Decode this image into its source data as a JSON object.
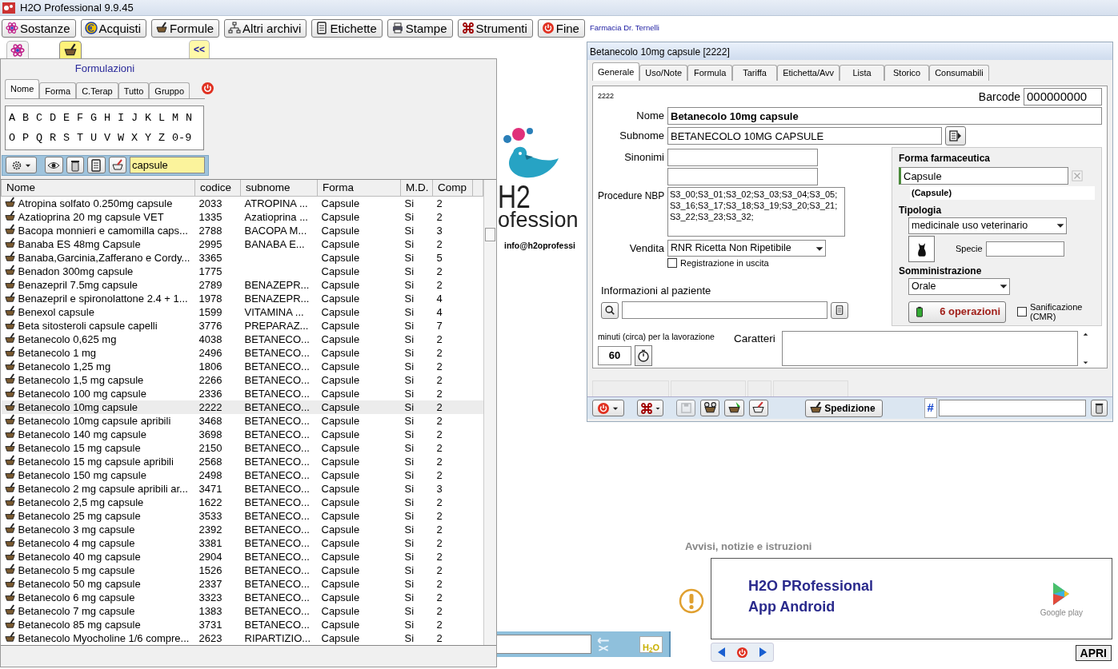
{
  "window": {
    "title": "H2O Professional 9.9.45"
  },
  "toolbar": {
    "buttons": [
      "Sostanze",
      "Acquisti",
      "Formule",
      "Altri archivi",
      "Etichette",
      "Stampe",
      "Strumenti",
      "Fine"
    ],
    "pharmacy": "Farmacia Dr. Ternelli"
  },
  "left_panel": {
    "top_tabs": [
      {
        "selected": false
      },
      {
        "selected": true
      }
    ],
    "collapse_button": "<<",
    "title": "Formulazioni",
    "filter_tabs": [
      {
        "label": "Nome",
        "selected": true
      },
      {
        "label": "Forma",
        "selected": false
      },
      {
        "label": "C.Terap",
        "selected": false
      },
      {
        "label": "Tutto",
        "selected": false
      },
      {
        "label": "Gruppo",
        "selected": false
      }
    ],
    "letters": [
      [
        "A",
        "B",
        "C",
        "D",
        "E",
        "F",
        "G",
        "H",
        "I",
        "J",
        "K",
        "L",
        "M",
        "N"
      ],
      [
        "O",
        "P",
        "Q",
        "R",
        "S",
        "T",
        "U",
        "V",
        "W",
        "X",
        "Y",
        "Z",
        "0-9"
      ]
    ],
    "search": {
      "value": "capsule"
    },
    "table": {
      "columns": [
        "Nome",
        "codice",
        "subnome",
        "Forma",
        "M.D.",
        "Comp"
      ],
      "rows": [
        {
          "nome": "Atropina solfato 0.250mg capsule",
          "codice": "2033",
          "subnome": "ATROPINA ...",
          "forma": "Capsule",
          "md": "Si",
          "comp": "2",
          "selected": false
        },
        {
          "nome": "Azatioprina 20 mg capsule VET",
          "codice": "1335",
          "subnome": "Azatioprina ...",
          "forma": "Capsule",
          "md": "Si",
          "comp": "2",
          "selected": false
        },
        {
          "nome": "Bacopa monnieri e camomilla caps...",
          "codice": "2788",
          "subnome": "BACOPA M...",
          "forma": "Capsule",
          "md": "Si",
          "comp": "3",
          "selected": false
        },
        {
          "nome": "Banaba ES  48mg Capsule",
          "codice": "2995",
          "subnome": "BANABA E...",
          "forma": "Capsule",
          "md": "Si",
          "comp": "2",
          "selected": false
        },
        {
          "nome": "Banaba,Garcinia,Zafferano e Cordy...",
          "codice": "3365",
          "forma": "Capsule",
          "md": "Si",
          "comp": "5",
          "selected": false
        },
        {
          "nome": "Benadon 300mg capsule",
          "codice": "1775",
          "forma": "Capsule",
          "md": "Si",
          "comp": "2",
          "selected": false
        },
        {
          "nome": "Benazepril 7.5mg capsule",
          "codice": "2789",
          "subnome": "BENAZEPR...",
          "forma": "Capsule",
          "md": "Si",
          "comp": "2",
          "selected": false
        },
        {
          "nome": "Benazepril e spironolattone 2.4 + 1...",
          "codice": "1978",
          "subnome": "BENAZEPR...",
          "forma": "Capsule",
          "md": "Si",
          "comp": "4",
          "selected": false
        },
        {
          "nome": "Benexol capsule",
          "codice": "1599",
          "subnome": "VITAMINA ...",
          "forma": "Capsule",
          "md": "Si",
          "comp": "4",
          "selected": false
        },
        {
          "nome": "Beta sitosteroli capsule capelli",
          "codice": "3776",
          "subnome": "PREPARAZ...",
          "forma": "Capsule",
          "md": "Si",
          "comp": "7",
          "selected": false
        },
        {
          "nome": "Betanecolo 0,625 mg",
          "codice": "4038",
          "subnome": "BETANECO...",
          "forma": "Capsule",
          "md": "Si",
          "comp": "2",
          "selected": false
        },
        {
          "nome": "Betanecolo 1 mg",
          "codice": "2496",
          "subnome": "BETANECO...",
          "forma": "Capsule",
          "md": "Si",
          "comp": "2",
          "selected": false
        },
        {
          "nome": "Betanecolo 1,25 mg",
          "codice": "1806",
          "subnome": "BETANECO...",
          "forma": "Capsule",
          "md": "Si",
          "comp": "2",
          "selected": false
        },
        {
          "nome": "Betanecolo 1,5 mg capsule",
          "codice": "2266",
          "subnome": "BETANECO...",
          "forma": "Capsule",
          "md": "Si",
          "comp": "2",
          "selected": false
        },
        {
          "nome": "Betanecolo 100 mg capsule",
          "codice": "2336",
          "subnome": "BETANECO...",
          "forma": "Capsule",
          "md": "Si",
          "comp": "2",
          "selected": false
        },
        {
          "nome": "Betanecolo 10mg capsule",
          "codice": "2222",
          "subnome": "BETANECO...",
          "forma": "Capsule",
          "md": "Si",
          "comp": "2",
          "selected": true
        },
        {
          "nome": "Betanecolo 10mg capsule apribili",
          "codice": "3468",
          "subnome": "BETANECO...",
          "forma": "Capsule",
          "md": "Si",
          "comp": "2",
          "selected": false
        },
        {
          "nome": "Betanecolo 140 mg capsule",
          "codice": "3698",
          "subnome": "BETANECO...",
          "forma": "Capsule",
          "md": "Si",
          "comp": "2",
          "selected": false
        },
        {
          "nome": "Betanecolo 15 mg capsule",
          "codice": "2150",
          "subnome": "BETANECO...",
          "forma": "Capsule",
          "md": "Si",
          "comp": "2",
          "selected": false
        },
        {
          "nome": "Betanecolo 15 mg capsule apribili",
          "codice": "2568",
          "subnome": "BETANECO...",
          "forma": "Capsule",
          "md": "Si",
          "comp": "2",
          "selected": false
        },
        {
          "nome": "Betanecolo 150 mg capsule",
          "codice": "2498",
          "subnome": "BETANECO...",
          "forma": "Capsule",
          "md": "Si",
          "comp": "2",
          "selected": false
        },
        {
          "nome": "Betanecolo 2 mg capsule apribili ar...",
          "codice": "3471",
          "subnome": "BETANECO...",
          "forma": "Capsule",
          "md": "Si",
          "comp": "3",
          "selected": false
        },
        {
          "nome": "Betanecolo 2,5 mg capsule",
          "codice": "1622",
          "subnome": "BETANECO...",
          "forma": "Capsule",
          "md": "Si",
          "comp": "2",
          "selected": false
        },
        {
          "nome": "Betanecolo 25 mg capsule",
          "codice": "3533",
          "subnome": "BETANECO...",
          "forma": "Capsule",
          "md": "Si",
          "comp": "2",
          "selected": false
        },
        {
          "nome": "Betanecolo 3 mg capsule",
          "codice": "2392",
          "subnome": "BETANECO...",
          "forma": "Capsule",
          "md": "Si",
          "comp": "2",
          "selected": false
        },
        {
          "nome": "Betanecolo 4 mg capsule",
          "codice": "3381",
          "subnome": "BETANECO...",
          "forma": "Capsule",
          "md": "Si",
          "comp": "2",
          "selected": false
        },
        {
          "nome": "Betanecolo 40 mg capsule",
          "codice": "2904",
          "subnome": "BETANECO...",
          "forma": "Capsule",
          "md": "Si",
          "comp": "2",
          "selected": false
        },
        {
          "nome": "Betanecolo 5 mg capsule",
          "codice": "1526",
          "subnome": "BETANECO...",
          "forma": "Capsule",
          "md": "Si",
          "comp": "2",
          "selected": false
        },
        {
          "nome": "Betanecolo 50 mg capsule",
          "codice": "2337",
          "subnome": "BETANECO...",
          "forma": "Capsule",
          "md": "Si",
          "comp": "2",
          "selected": false
        },
        {
          "nome": "Betanecolo 6 mg capsule",
          "codice": "3323",
          "subnome": "BETANECO...",
          "forma": "Capsule",
          "md": "Si",
          "comp": "2",
          "selected": false
        },
        {
          "nome": "Betanecolo 7 mg capsule",
          "codice": "1383",
          "subnome": "BETANECO...",
          "forma": "Capsule",
          "md": "Si",
          "comp": "2",
          "selected": false
        },
        {
          "nome": "Betanecolo 85 mg capsule",
          "codice": "3731",
          "subnome": "BETANECO...",
          "forma": "Capsule",
          "md": "Si",
          "comp": "2",
          "selected": false
        },
        {
          "nome": "Betanecolo Myocholine 1/6 compre...",
          "codice": "2623",
          "subnome": "RIPARTIZIO...",
          "forma": "Capsule",
          "md": "Si",
          "comp": "2",
          "selected": false
        }
      ]
    }
  },
  "logo": {
    "line1": "H2",
    "line2": "ofession",
    "email": "info@h2oprofessi"
  },
  "dialog": {
    "title": "Betanecolo 10mg capsule  [2222]",
    "tabs": [
      {
        "label": "Generale",
        "selected": true
      },
      {
        "label": "Uso/Note",
        "selected": false
      },
      {
        "label": "Formula",
        "selected": false
      },
      {
        "label": "Tariffa",
        "selected": false
      },
      {
        "label": "Etichetta/Avv",
        "selected": false
      },
      {
        "label": "Lista",
        "selected": false
      },
      {
        "label": "Storico",
        "selected": false
      },
      {
        "label": "Consumabili",
        "selected": false
      }
    ],
    "code": "2222",
    "barcode_label": "Barcode",
    "barcode": "000000000",
    "nome_label": "Nome",
    "nome": "Betanecolo 10mg capsule",
    "subnome_label": "Subnome",
    "subnome": "BETANECOLO 10MG CAPSULE",
    "sinonimi_label": "Sinonimi",
    "procedure_label": "Procedure NBP",
    "procedure": "S3_00;S3_01;S3_02;S3_03;S3_04;S3_05;S3_16;S3_17;S3_18;S3_19;S3_20;S3_21;S3_22;S3_23;S3_32;",
    "vendita_label": "Vendita",
    "vendita": "RNR Ricetta Non Ripetibile",
    "registrazione": {
      "label": "Registrazione in uscita",
      "checked": false
    },
    "info_label": "Informazioni al paziente",
    "minutes_label": "minuti (circa) per la lavorazione",
    "minutes": "60",
    "caratteri_label": "Caratteri",
    "forma_label": "Forma farmaceutica",
    "forma": "Capsule",
    "forma_note": "(Capsule)",
    "tipologia_label": "Tipologia",
    "tipologia": "medicinale uso veterinario",
    "specie_label": "Specie",
    "somministrazione_label": "Somministrazione",
    "somministrazione": "Orale",
    "operations_button": "6 operazioni",
    "sanificazione": {
      "label": "Sanificazione (CMR)",
      "checked": false
    },
    "spedizione_button": "Spedizione",
    "hash_label": "#"
  },
  "bottom_strip": {
    "badge": "H$_{2}$O"
  },
  "notices": {
    "title": "Avvisi, notizie e istruzioni",
    "line1": "H2O PRofessional",
    "line2": "App Android",
    "store": "Google play",
    "open_button": "APRI"
  }
}
